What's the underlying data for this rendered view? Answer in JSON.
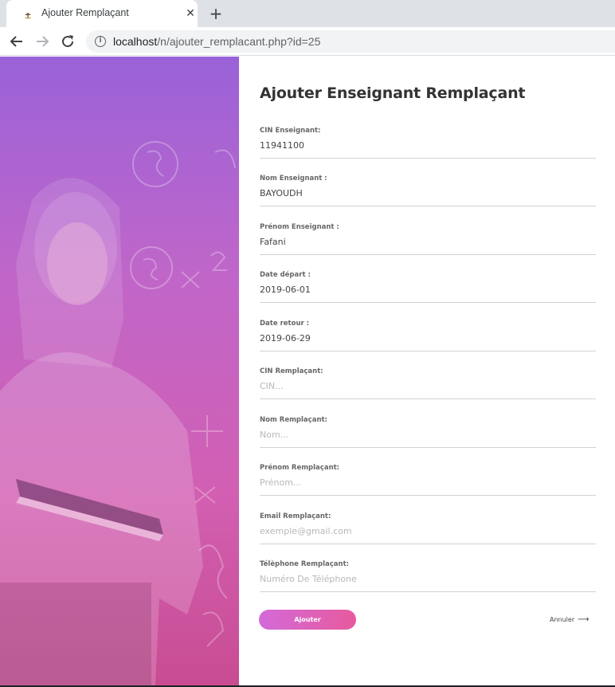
{
  "browser": {
    "tab_title": "Ajouter Remplaçant",
    "close_glyph": "✕",
    "new_tab_glyph": "+",
    "url_host": "localhost",
    "url_path": "/n/ajouter_remplacant.php?id=25"
  },
  "form": {
    "title": "Ajouter Enseignant Remplaçant",
    "fields": [
      {
        "label": "CIN Enseignant:",
        "value": "11941100",
        "placeholder": ""
      },
      {
        "label": "Nom Enseignant :",
        "value": "BAYOUDH",
        "placeholder": ""
      },
      {
        "label": "Prénom Enseignant :",
        "value": "Fafani",
        "placeholder": ""
      },
      {
        "label": "Date départ :",
        "value": "2019-06-01",
        "placeholder": ""
      },
      {
        "label": "Date retour :",
        "value": "2019-06-29",
        "placeholder": ""
      },
      {
        "label": "CIN Remplaçant:",
        "value": "",
        "placeholder": "CIN..."
      },
      {
        "label": "Nom Remplaçant:",
        "value": "",
        "placeholder": "Nom..."
      },
      {
        "label": "Prénom Remplaçant:",
        "value": "",
        "placeholder": "Prénom..."
      },
      {
        "label": "Email Remplaçant:",
        "value": "",
        "placeholder": "exemple@gmail.com"
      },
      {
        "label": "Télèphone Remplaçant:",
        "value": "",
        "placeholder": "Numéro De Téléphone"
      }
    ],
    "submit_label": "Ajouter",
    "cancel_label": "Annuler",
    "cancel_arrow": "⟶"
  },
  "colors": {
    "accent_start": "#d36ad8",
    "accent_end": "#e75a9e",
    "hero_top": "#9a62d8",
    "hero_bottom": "#c84c92"
  },
  "icons": [
    "site-favicon-icon",
    "close-icon",
    "plus-icon",
    "back-arrow-icon",
    "forward-arrow-icon",
    "reload-icon",
    "info-icon",
    "arrow-right-icon"
  ]
}
